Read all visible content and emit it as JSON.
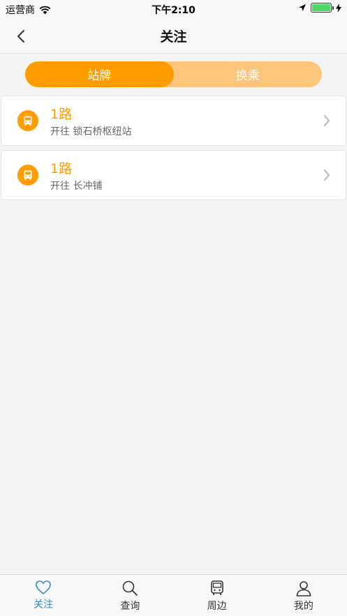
{
  "status_bar": {
    "carrier": "运营商",
    "time": "下午2:10",
    "battery_level": 1.0
  },
  "nav": {
    "title": "关注"
  },
  "segment": {
    "tabs": [
      {
        "label": "站牌",
        "active": true
      },
      {
        "label": "换乘",
        "active": false
      }
    ]
  },
  "routes": [
    {
      "name": "1路",
      "destination": "开往 锁石桥枢纽站"
    },
    {
      "name": "1路",
      "destination": "开往 长冲铺"
    }
  ],
  "tabbar": {
    "items": [
      {
        "label": "关注",
        "icon": "heart-icon",
        "active": true
      },
      {
        "label": "查询",
        "icon": "search-icon",
        "active": false
      },
      {
        "label": "周边",
        "icon": "bus-icon",
        "active": false
      },
      {
        "label": "我的",
        "icon": "user-icon",
        "active": false
      }
    ]
  },
  "colors": {
    "accent": "#ff9c00",
    "accent_light": "#fbc67c",
    "tab_active": "#3a86c8"
  }
}
